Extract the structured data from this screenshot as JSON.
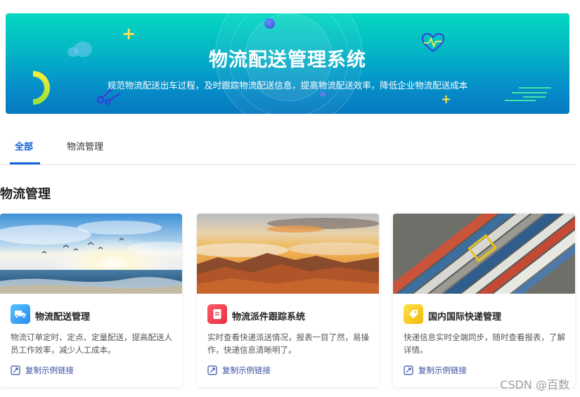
{
  "banner": {
    "title": "物流配送管理系统",
    "subtitle": "规范物流配送出车过程，及时跟踪物流配送信息，提高物流配送效率，降低企业物流配送成本"
  },
  "tabs": [
    {
      "label": "全部",
      "active": true
    },
    {
      "label": "物流管理",
      "active": false
    }
  ],
  "section": {
    "title": "物流管理"
  },
  "cards": [
    {
      "title": "物流配送管理",
      "description": "物流订单定时、定点、定量配送，提高配送人员工作效率，减少人工成本。",
      "link_label": "复制示例链接",
      "icon": "delivery-truck-icon",
      "icon_color": "#2aa0f5"
    },
    {
      "title": "物流派件跟踪系统",
      "description": "实时查看快递派送情况，报表一目了然，易操作，快递信息清晰明了。",
      "link_label": "复制示例链接",
      "icon": "document-icon",
      "icon_color": "#f0414f"
    },
    {
      "title": "国内国际快递管理",
      "description": "快递信息实时全端同步，随时查看报表，了解详情。",
      "link_label": "复制示例链接",
      "icon": "tag-icon",
      "icon_color": "#f5c816"
    }
  ],
  "watermark": "CSDN @百数",
  "colors": {
    "accent": "#1463d8",
    "banner_top": "#05d8c0",
    "banner_bottom": "#0778c0"
  }
}
